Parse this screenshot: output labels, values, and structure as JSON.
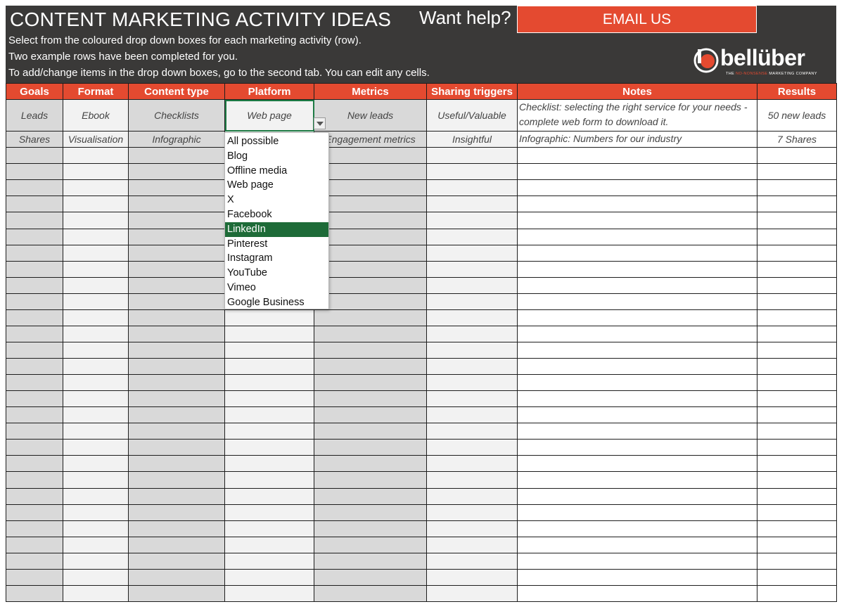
{
  "header": {
    "title": "CONTENT MARKETING ACTIVITY IDEAS",
    "instructions": [
      "Select from the coloured drop down boxes for each marketing activity (row).",
      "Two example rows have been completed for you.",
      "To add/change items in the drop down boxes, go to the second tab. You can edit any cells."
    ],
    "want_help": "Want help?",
    "email_button": "EMAIL US",
    "logo_word": "bellüber",
    "logo_tag_pre": "THE ",
    "logo_tag_accent": "NO-NONSENSE",
    "logo_tag_post": " MARKETING COMPANY"
  },
  "columns": [
    "Goals",
    "Format",
    "Content type",
    "Platform",
    "Metrics",
    "Sharing triggers",
    "Notes",
    "Results"
  ],
  "rows": [
    [
      "Leads",
      "Ebook",
      "Checklists",
      "Web page",
      "New leads",
      "Useful/Valuable",
      "Checklist: selecting the right service for your needs - complete web form to download it.",
      "50 new leads"
    ],
    [
      "Shares",
      "Visualisation",
      "Infographic",
      "",
      "Engagement metrics",
      "Insightful",
      "Infographic: Numbers for our industry",
      "7 Shares"
    ]
  ],
  "dropdown": {
    "options": [
      "All possible",
      "Blog",
      "Offline media",
      "Web page",
      "X",
      "Facebook",
      "LinkedIn",
      "Pinterest",
      "Instagram",
      "YouTube",
      "Vimeo",
      "Google Business"
    ],
    "highlighted": "LinkedIn"
  },
  "colors": {
    "header_bg": "#3a3938",
    "accent": "#e44a30",
    "dropdown_highlight": "#1e6b38",
    "selected_cell_border": "#1e7b45"
  }
}
